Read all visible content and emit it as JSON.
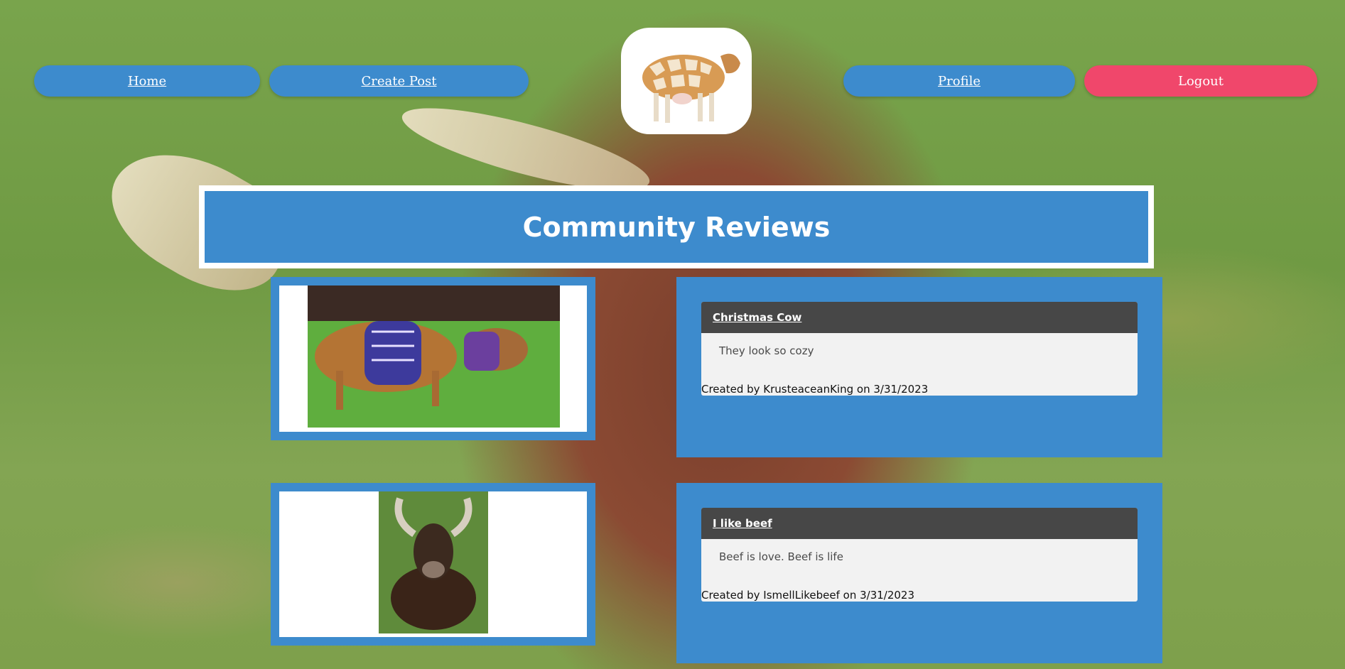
{
  "nav": {
    "home": "Home",
    "create_post": "Create Post",
    "profile": "Profile",
    "logout": "Logout"
  },
  "page_title": "Community Reviews",
  "posts": [
    {
      "title": "Christmas Cow",
      "body": "They look so cozy",
      "meta": "Created by KrusteaceanKing on 3/31/2023",
      "image_icon": "cows-in-sweaters-photo"
    },
    {
      "title": "I like beef",
      "body": "Beef is love. Beef is life",
      "meta": "Created by IsmellLikebeef on 3/31/2023",
      "image_icon": "sitting-bull-photo"
    }
  ],
  "colors": {
    "primary": "#3d8bcd",
    "logout": "#f0476b",
    "card_header": "#474747"
  }
}
